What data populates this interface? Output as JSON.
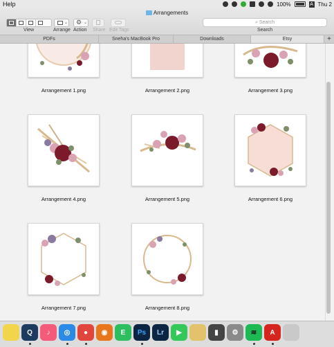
{
  "menubar": {
    "app_menu": "Help",
    "battery": "100%",
    "input_source": "A",
    "clock": "Thu 2"
  },
  "window": {
    "title": "Arrangements",
    "toolbar": {
      "view_label": "View",
      "arrange_label": "Arrange",
      "action_label": "Action",
      "share_label": "Share",
      "edit_tags_label": "Edit Tags",
      "search_label": "Search",
      "search_placeholder": "Search"
    },
    "tabs": [
      {
        "label": "PDFs",
        "active": false
      },
      {
        "label": "Sneha's MacBook Pro",
        "active": false
      },
      {
        "label": "Downloads",
        "active": false
      },
      {
        "label": "Etsy",
        "active": true
      }
    ],
    "files": [
      {
        "name": "Arrangement 1.png",
        "art": "wreath-top-right"
      },
      {
        "name": "Arrangement 2.png",
        "art": "pink-square"
      },
      {
        "name": "Arrangement 3.png",
        "art": "bouquet-top"
      },
      {
        "name": "Arrangement 4.png",
        "art": "bouquet-center"
      },
      {
        "name": "Arrangement 5.png",
        "art": "bouquet-swag"
      },
      {
        "name": "Arrangement 6.png",
        "art": "hexagon-filled"
      },
      {
        "name": "Arrangement 7.png",
        "art": "hexagon-frame"
      },
      {
        "name": "Arrangement 8.png",
        "art": "circle-frame"
      }
    ]
  },
  "colors": {
    "burgundy": "#7a1a2b",
    "blush": "#f3d5cf",
    "dusty_pink": "#d9a3b4",
    "wheat": "#d8b98e",
    "sage": "#7e8f6a",
    "accent_blue": "#2f7be9"
  },
  "dock": {
    "apps": [
      {
        "name": "Stickies",
        "color": "#f2d54d",
        "glyph": ""
      },
      {
        "name": "QuickTime Player",
        "color": "#1d3a5f",
        "glyph": "Q"
      },
      {
        "name": "Music",
        "color": "#f45a7a",
        "glyph": "♪"
      },
      {
        "name": "Safari",
        "color": "#2b8ae6",
        "glyph": "◎"
      },
      {
        "name": "Google Chrome",
        "color": "#e0463c",
        "glyph": "●"
      },
      {
        "name": "Firefox",
        "color": "#e8761d",
        "glyph": "◉"
      },
      {
        "name": "Evernote",
        "color": "#2dbe60",
        "glyph": "E"
      },
      {
        "name": "Adobe Photoshop",
        "color": "#0b2542",
        "glyph": "Ps"
      },
      {
        "name": "Adobe Lightroom",
        "color": "#0b2542",
        "glyph": "Lr"
      },
      {
        "name": "FaceTime",
        "color": "#34c759",
        "glyph": "▶"
      },
      {
        "name": "Notes",
        "color": "#e2c26a",
        "glyph": ""
      },
      {
        "name": "Activity Monitor",
        "color": "#444444",
        "glyph": "▮"
      },
      {
        "name": "System Preferences",
        "color": "#8a8a8a",
        "glyph": "⚙"
      },
      {
        "name": "Spotify",
        "color": "#1db954",
        "glyph": "≋"
      },
      {
        "name": "Adobe Acrobat",
        "color": "#d6241f",
        "glyph": "A"
      },
      {
        "name": "Preview",
        "color": "#c9c9c9",
        "glyph": ""
      }
    ]
  }
}
